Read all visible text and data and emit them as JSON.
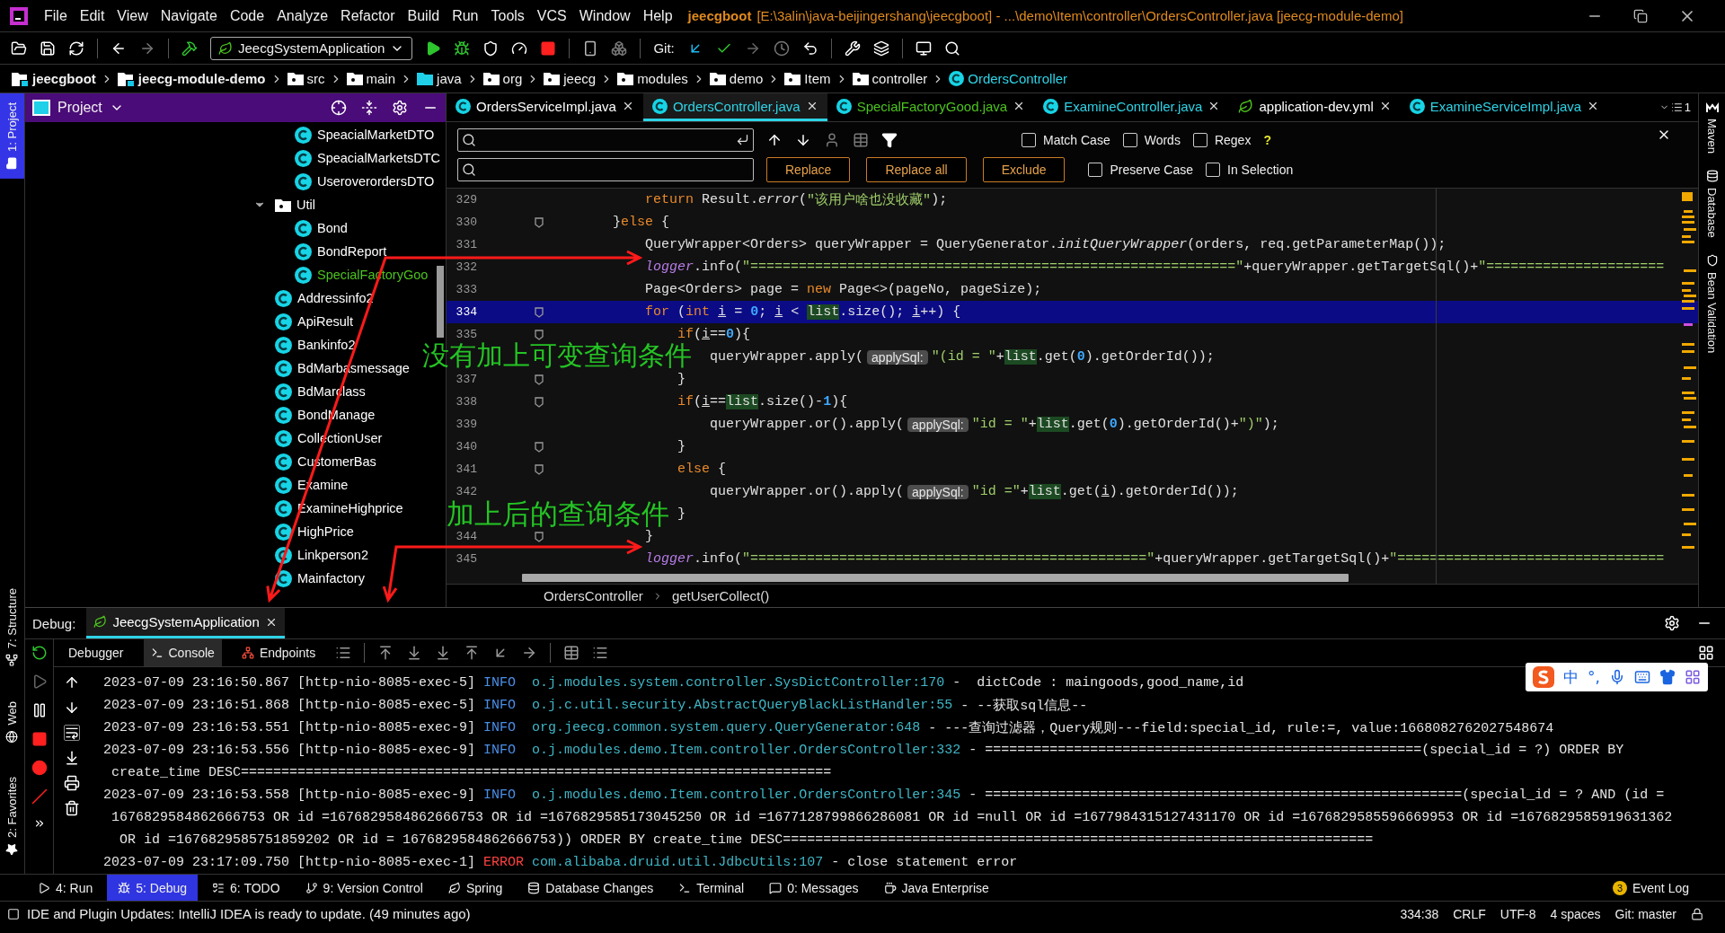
{
  "window": {
    "project": "jeecgboot",
    "path": "[E:\\3alin\\java-beijingershang\\jeecgboot] - ...\\demo\\Item\\controller\\OrdersController.java [jeecg-module-demo]"
  },
  "menu": [
    "File",
    "Edit",
    "View",
    "Navigate",
    "Code",
    "Analyze",
    "Refactor",
    "Build",
    "Run",
    "Tools",
    "VCS",
    "Window",
    "Help"
  ],
  "toolbar": {
    "run_config": "JeecgSystemApplication",
    "git_label": "Git:"
  },
  "breadcrumb": [
    {
      "label": "jeecgboot",
      "kind": "module"
    },
    {
      "label": "jeecg-module-demo",
      "kind": "module"
    },
    {
      "label": "src",
      "kind": "folder"
    },
    {
      "label": "main",
      "kind": "folder"
    },
    {
      "label": "java",
      "kind": "source"
    },
    {
      "label": "org",
      "kind": "package"
    },
    {
      "label": "jeecg",
      "kind": "package"
    },
    {
      "label": "modules",
      "kind": "package"
    },
    {
      "label": "demo",
      "kind": "package"
    },
    {
      "label": "Item",
      "kind": "package"
    },
    {
      "label": "controller",
      "kind": "package"
    },
    {
      "label": "OrdersController",
      "kind": "class"
    }
  ],
  "left_strip": {
    "top": [
      {
        "label": "1: Project",
        "selected": true
      }
    ],
    "bottom": [
      {
        "label": "7: Structure",
        "selected": false
      },
      {
        "label": "Web",
        "selected": false
      },
      {
        "label": "2: Favorites",
        "selected": false
      }
    ]
  },
  "right_strip": [
    "Maven",
    "Database",
    "Bean Validation"
  ],
  "project": {
    "title": "Project",
    "tree_tail": [
      {
        "label": "SpeacialMarketDTO",
        "kind": "class",
        "modified": false
      },
      {
        "label": "SpeacialMarketsDTC",
        "kind": "class",
        "modified": false
      },
      {
        "label": "UseroverordersDTO",
        "kind": "class",
        "modified": false
      }
    ],
    "tree": [
      {
        "label": "Util",
        "kind": "folder",
        "expanded": true,
        "modified": false,
        "children": [
          {
            "label": "Bond",
            "kind": "class",
            "modified": false
          },
          {
            "label": "BondReport",
            "kind": "class",
            "modified": false
          },
          {
            "label": "SpecialFactoryGoo",
            "kind": "class",
            "modified": true
          }
        ]
      },
      {
        "label": "Addressinfo2",
        "kind": "class",
        "modified": false
      },
      {
        "label": "ApiResult",
        "kind": "class",
        "modified": false
      },
      {
        "label": "Bankinfo2",
        "kind": "class",
        "modified": false
      },
      {
        "label": "BdMarbasmessage",
        "kind": "class",
        "modified": false
      },
      {
        "label": "BdMarclass",
        "kind": "class",
        "modified": false
      },
      {
        "label": "BondManage",
        "kind": "class",
        "modified": false
      },
      {
        "label": "CollectionUser",
        "kind": "class",
        "modified": false
      },
      {
        "label": "CustomerBas",
        "kind": "class",
        "modified": false
      },
      {
        "label": "Examine",
        "kind": "class",
        "modified": false
      },
      {
        "label": "ExamineHighprice",
        "kind": "class",
        "modified": false
      },
      {
        "label": "HighPrice",
        "kind": "class",
        "modified": false
      },
      {
        "label": "Linkperson2",
        "kind": "class",
        "modified": false
      },
      {
        "label": "Mainfactory",
        "kind": "class",
        "modified": false
      }
    ]
  },
  "tabs": [
    {
      "label": "OrdersServiceImpl.java",
      "kind": "class",
      "color": "#ffffff",
      "selected": false
    },
    {
      "label": "OrdersController.java",
      "kind": "class",
      "color": "#2ed3e6",
      "selected": true
    },
    {
      "label": "SpecialFactoryGood.java",
      "kind": "class",
      "color": "#4cc21e",
      "selected": false
    },
    {
      "label": "ExamineController.java",
      "kind": "class",
      "color": "#2ed3e6",
      "selected": false
    },
    {
      "label": "application-dev.yml",
      "kind": "config",
      "color": "#ffffff",
      "selected": false
    },
    {
      "label": "ExamineServiceImpl.java",
      "kind": "class",
      "color": "#2ed3e6",
      "selected": false
    }
  ],
  "tabs_overflow": "1",
  "find": {
    "options": [
      {
        "label": "Match Case",
        "checked": false
      },
      {
        "label": "Words",
        "checked": false
      },
      {
        "label": "Regex",
        "checked": false
      }
    ],
    "help": "?",
    "buttons": [
      "Replace",
      "Replace all",
      "Exclude"
    ],
    "options2": [
      {
        "label": "Preserve Case",
        "checked": false
      },
      {
        "label": "In Selection",
        "checked": false
      }
    ]
  },
  "code": [
    {
      "number": "329",
      "current": false,
      "fold": false,
      "tokens": [
        {
          "text": "            return",
          "kind": "keyword"
        },
        {
          "text": " Result.",
          "kind": "plain"
        },
        {
          "text": "error",
          "kind": "italic"
        },
        {
          "text": "(",
          "kind": "plain"
        },
        {
          "text": "\"该用户啥也没收藏\"",
          "kind": "string"
        },
        {
          "text": ");",
          "kind": "plain"
        }
      ]
    },
    {
      "number": "330",
      "current": false,
      "fold": true,
      "tokens": [
        {
          "text": "        }",
          "kind": "plain"
        },
        {
          "text": "else",
          "kind": "keyword"
        },
        {
          "text": " {",
          "kind": "plain"
        }
      ]
    },
    {
      "number": "331",
      "current": false,
      "fold": false,
      "tokens": [
        {
          "text": "            QueryWrapper<Orders> queryWrapper = QueryGenerator.",
          "kind": "plain"
        },
        {
          "text": "initQueryWrapper",
          "kind": "italic"
        },
        {
          "text": "(orders, req.getParameterMap());",
          "kind": "plain"
        }
      ]
    },
    {
      "number": "332",
      "current": false,
      "fold": false,
      "tokens": [
        {
          "text": "            logger",
          "kind": "field"
        },
        {
          "text": ".info(",
          "kind": "plain"
        },
        {
          "text": "\"============================================================\"",
          "kind": "string"
        },
        {
          "text": "+queryWrapper.getTargetSql()+",
          "kind": "plain"
        },
        {
          "text": "\"======================",
          "kind": "string"
        }
      ]
    },
    {
      "number": "333",
      "current": false,
      "fold": false,
      "tokens": [
        {
          "text": "            Page<Orders> page = ",
          "kind": "plain"
        },
        {
          "text": "new",
          "kind": "keyword"
        },
        {
          "text": " Page<>(pageNo, pageSize);",
          "kind": "plain"
        }
      ]
    },
    {
      "number": "334",
      "current": true,
      "fold": true,
      "tokens": [
        {
          "text": "            for",
          "kind": "keyword"
        },
        {
          "text": " (",
          "kind": "plain"
        },
        {
          "text": "int ",
          "kind": "keyword"
        },
        {
          "text": "i",
          "kind": "var"
        },
        {
          "text": " = ",
          "kind": "plain"
        },
        {
          "text": "0",
          "kind": "number"
        },
        {
          "text": "; ",
          "kind": "plain"
        },
        {
          "text": "i",
          "kind": "var"
        },
        {
          "text": " < ",
          "kind": "plain"
        },
        {
          "text": "list",
          "kind": "highlight"
        },
        {
          "text": ".size(); ",
          "kind": "plain"
        },
        {
          "text": "i",
          "kind": "var"
        },
        {
          "text": "++) {",
          "kind": "plain"
        }
      ]
    },
    {
      "number": "335",
      "current": false,
      "fold": true,
      "tokens": [
        {
          "text": "                if",
          "kind": "keyword"
        },
        {
          "text": "(",
          "kind": "plain"
        },
        {
          "text": "i",
          "kind": "var"
        },
        {
          "text": "==",
          "kind": "plain"
        },
        {
          "text": "0",
          "kind": "number"
        },
        {
          "text": "){",
          "kind": "plain"
        }
      ]
    },
    {
      "current": false,
      "fold": false,
      "tokens": [
        {
          "text": "                    queryWrapper.apply(",
          "kind": "plain"
        },
        {
          "text": "applySql:",
          "kind": "hint"
        },
        {
          "text": "\"(id = \"",
          "kind": "string"
        },
        {
          "text": "+",
          "kind": "plain"
        },
        {
          "text": "list",
          "kind": "highlight"
        },
        {
          "text": ".get(",
          "kind": "plain"
        },
        {
          "text": "0",
          "kind": "number"
        },
        {
          "text": ").getOrderId());",
          "kind": "plain"
        }
      ]
    },
    {
      "number": "337",
      "current": false,
      "fold": true,
      "tokens": [
        {
          "text": "                }",
          "kind": "plain"
        }
      ]
    },
    {
      "number": "338",
      "current": false,
      "fold": true,
      "tokens": [
        {
          "text": "                if",
          "kind": "keyword"
        },
        {
          "text": "(",
          "kind": "plain"
        },
        {
          "text": "i",
          "kind": "var"
        },
        {
          "text": "==",
          "kind": "plain"
        },
        {
          "text": "list",
          "kind": "highlight"
        },
        {
          "text": ".size()-",
          "kind": "plain"
        },
        {
          "text": "1",
          "kind": "number"
        },
        {
          "text": "){",
          "kind": "plain"
        }
      ]
    },
    {
      "number": "339",
      "current": false,
      "fold": false,
      "tokens": [
        {
          "text": "                    queryWrapper.or().apply(",
          "kind": "plain"
        },
        {
          "text": "applySql:",
          "kind": "hint"
        },
        {
          "text": "\"id = \"",
          "kind": "string"
        },
        {
          "text": "+",
          "kind": "plain"
        },
        {
          "text": "list",
          "kind": "highlight"
        },
        {
          "text": ".get(",
          "kind": "plain"
        },
        {
          "text": "0",
          "kind": "number"
        },
        {
          "text": ").getOrderId()+",
          "kind": "plain"
        },
        {
          "text": "\")\"",
          "kind": "string"
        },
        {
          "text": ");",
          "kind": "plain"
        }
      ]
    },
    {
      "number": "340",
      "current": false,
      "fold": true,
      "tokens": [
        {
          "text": "                }",
          "kind": "plain"
        }
      ]
    },
    {
      "number": "341",
      "current": false,
      "fold": true,
      "tokens": [
        {
          "text": "                else",
          "kind": "keyword"
        },
        {
          "text": " {",
          "kind": "plain"
        }
      ]
    },
    {
      "number": "342",
      "current": false,
      "fold": false,
      "tokens": [
        {
          "text": "                    queryWrapper.or().apply(",
          "kind": "plain"
        },
        {
          "text": "applySql:",
          "kind": "hint"
        },
        {
          "text": "\"id =\"",
          "kind": "string"
        },
        {
          "text": "+",
          "kind": "plain"
        },
        {
          "text": "list",
          "kind": "highlight"
        },
        {
          "text": ".get(",
          "kind": "plain"
        },
        {
          "text": "i",
          "kind": "var"
        },
        {
          "text": ").getOrderId());",
          "kind": "plain"
        }
      ]
    },
    {
      "current": false,
      "fold": false,
      "tokens": [
        {
          "text": "                }",
          "kind": "plain"
        }
      ]
    },
    {
      "number": "344",
      "current": false,
      "fold": true,
      "tokens": [
        {
          "text": "            }",
          "kind": "plain"
        }
      ]
    },
    {
      "number": "345",
      "current": false,
      "fold": false,
      "tokens": [
        {
          "text": "            logger",
          "kind": "field"
        },
        {
          "text": ".info(",
          "kind": "plain"
        },
        {
          "text": "\"=================================================\"",
          "kind": "string"
        },
        {
          "text": "+queryWrapper.getTargetSql()+",
          "kind": "plain"
        },
        {
          "text": "\"=================================",
          "kind": "string"
        }
      ]
    }
  ],
  "editor_breadcrumb": [
    "OrdersController",
    "getUserCollect()"
  ],
  "annotations": [
    {
      "text": "没有加上可变查询条件"
    },
    {
      "text": "加上后的查询条件"
    }
  ],
  "debug": {
    "label": "Debug:",
    "session": "JeecgSystemApplication",
    "tabs": [
      {
        "label": "Debugger",
        "selected": false
      },
      {
        "label": "Console",
        "selected": true
      },
      {
        "label": "Endpoints",
        "selected": false
      }
    ],
    "console": [
      [
        {
          "text": "2023-07-09 23:16:50.867 [http-nio-8085-exec-5] ",
          "kind": "plain"
        },
        {
          "text": "INFO",
          "kind": "info"
        },
        {
          "text": "  o.j.modules.system.controller.SysDictController:170",
          "kind": "logger"
        },
        {
          "text": " -  dictCode : maingoods,good_name,id",
          "kind": "plain"
        }
      ],
      [
        {
          "text": "2023-07-09 23:16:51.868 [http-nio-8085-exec-5] ",
          "kind": "plain"
        },
        {
          "text": "INFO",
          "kind": "info"
        },
        {
          "text": "  o.j.c.util.security.AbstractQueryBlackListHandler:55",
          "kind": "logger"
        },
        {
          "text": " - --获取sql信息--",
          "kind": "plain"
        }
      ],
      [
        {
          "text": "2023-07-09 23:16:53.551 [http-nio-8085-exec-9] ",
          "kind": "plain"
        },
        {
          "text": "INFO",
          "kind": "info"
        },
        {
          "text": "  org.jeecg.common.system.query.QueryGenerator:648",
          "kind": "logger"
        },
        {
          "text": " - ---查询过滤器，Query规则---field:special_id, rule:=, value:1668082762027548674",
          "kind": "plain"
        }
      ],
      [
        {
          "text": "2023-07-09 23:16:53.556 [http-nio-8085-exec-9] ",
          "kind": "plain"
        },
        {
          "text": "INFO",
          "kind": "info"
        },
        {
          "text": "  o.j.modules.demo.Item.controller.OrdersController:332",
          "kind": "logger"
        },
        {
          "text": " - ======================================================(special_id = ?) ORDER BY",
          "kind": "plain"
        }
      ],
      [
        {
          "text": " create_time DESC=========================================================================",
          "kind": "plain"
        }
      ],
      [
        {
          "text": "2023-07-09 23:16:53.558 [http-nio-8085-exec-9] ",
          "kind": "plain"
        },
        {
          "text": "INFO",
          "kind": "info"
        },
        {
          "text": "  o.j.modules.demo.Item.controller.OrdersController:345",
          "kind": "logger"
        },
        {
          "text": " - ===========================================================(special_id = ? AND (id =",
          "kind": "plain"
        }
      ],
      [
        {
          "text": " 1676829584862666753 OR id =1676829584862666753 OR id =1676829585173045250 OR id =1677128799866286081 OR id =null OR id =1677984315127431170 OR id =1676829585596669953 OR id =1676829585919631362",
          "kind": "plain"
        }
      ],
      [
        {
          "text": "  OR id =1676829585751859202 OR id = 1676829584862666753)) ORDER BY create_time DESC=========================================================================",
          "kind": "plain"
        }
      ],
      [
        {
          "text": "2023-07-09 23:17:09.750 [http-nio-8085-exec-1] ",
          "kind": "plain"
        },
        {
          "text": "ERROR",
          "kind": "error"
        },
        {
          "text": " com.alibaba.druid.util.JdbcUtils:107",
          "kind": "logger"
        },
        {
          "text": " - close statement error",
          "kind": "plain"
        }
      ]
    ]
  },
  "ime": {
    "mode": "中",
    "punctuation": "°,"
  },
  "tool_tabs": [
    {
      "label": "4: Run",
      "kind": "run",
      "selected": false
    },
    {
      "label": "5: Debug",
      "kind": "debug",
      "selected": true
    },
    {
      "label": "6: TODO",
      "kind": "todo",
      "selected": false
    },
    {
      "label": "9: Version Control",
      "kind": "vcs",
      "selected": false
    },
    {
      "label": "Spring",
      "kind": "spring",
      "selected": false
    },
    {
      "label": "Database Changes",
      "kind": "database",
      "selected": false
    },
    {
      "label": "Terminal",
      "kind": "terminal",
      "selected": false
    },
    {
      "label": "0: Messages",
      "kind": "messages",
      "selected": false
    },
    {
      "label": "Java Enterprise",
      "kind": "enterprise",
      "selected": false
    }
  ],
  "event_log": {
    "label": "Event Log",
    "count": "3"
  },
  "status": {
    "message": "IDE and Plugin Updates: IntelliJ IDEA is ready to update. (49 minutes ago)",
    "items": [
      "334:38",
      "CRLF",
      "UTF-8",
      "4 spaces",
      "Git: master"
    ]
  }
}
